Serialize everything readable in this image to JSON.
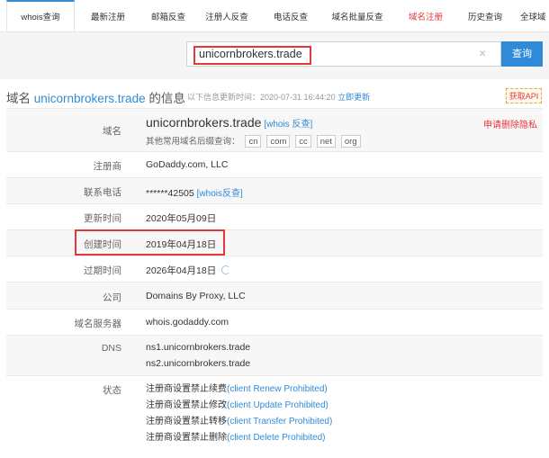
{
  "tabs": [
    {
      "label": "whois查询",
      "active": true
    },
    {
      "label": "最新注册"
    },
    {
      "label": "邮箱反查"
    },
    {
      "label": "注册人反查"
    },
    {
      "label": "电话反查"
    },
    {
      "label": "域名批量反查"
    },
    {
      "label": "域名注册",
      "color": "#e4393c"
    },
    {
      "label": "历史查询"
    },
    {
      "label": "全球域"
    }
  ],
  "search": {
    "value": "unicornbrokers.trade",
    "clear_icon": "×",
    "button_label": "查询"
  },
  "header": {
    "prefix": "域名",
    "domain": "unicornbrokers.trade",
    "suffix": "的信息",
    "update_info": "以下信息更新时间：2020-07-31 16:44:20",
    "update_link": "立即更新",
    "api_button": "获取API"
  },
  "rows": {
    "domain": {
      "label": "域名",
      "value": "unicornbrokers.trade",
      "whois_link": "[whois 反查]",
      "other_suffix_label": "其他常用域名后缀查询：",
      "suffixes": [
        "cn",
        "com",
        "cc",
        "net",
        "org"
      ],
      "privacy_link": "申请删除隐私"
    },
    "registrar": {
      "label": "注册商",
      "value": "GoDaddy.com, LLC"
    },
    "phone": {
      "label": "联系电话",
      "value": "******42505",
      "link": "[whois反查]"
    },
    "updated": {
      "label": "更新时间",
      "value": "2020年05月09日"
    },
    "created": {
      "label": "创建时间",
      "value": "2019年04月18日"
    },
    "expires": {
      "label": "过期时间",
      "value": "2026年04月18日"
    },
    "company": {
      "label": "公司",
      "value": "Domains By Proxy, LLC"
    },
    "nameserver": {
      "label": "域名服务器",
      "value": "whois.godaddy.com"
    },
    "dns": {
      "label": "DNS",
      "values": [
        "ns1.unicornbrokers.trade",
        "ns2.unicornbrokers.trade"
      ]
    },
    "status": {
      "label": "状态",
      "lines": [
        {
          "text": "注册商设置禁止续费",
          "code": "(client Renew Prohibited)"
        },
        {
          "text": "注册商设置禁止修改",
          "code": "(client Update Prohibited)"
        },
        {
          "text": "注册商设置禁止转移",
          "code": "(client Transfer Prohibited)"
        },
        {
          "text": "注册商设置禁止删除",
          "code": "(client Delete Prohibited)"
        }
      ]
    }
  },
  "colors": {
    "accent": "#2f8bd8",
    "highlight": "#e4393c"
  }
}
